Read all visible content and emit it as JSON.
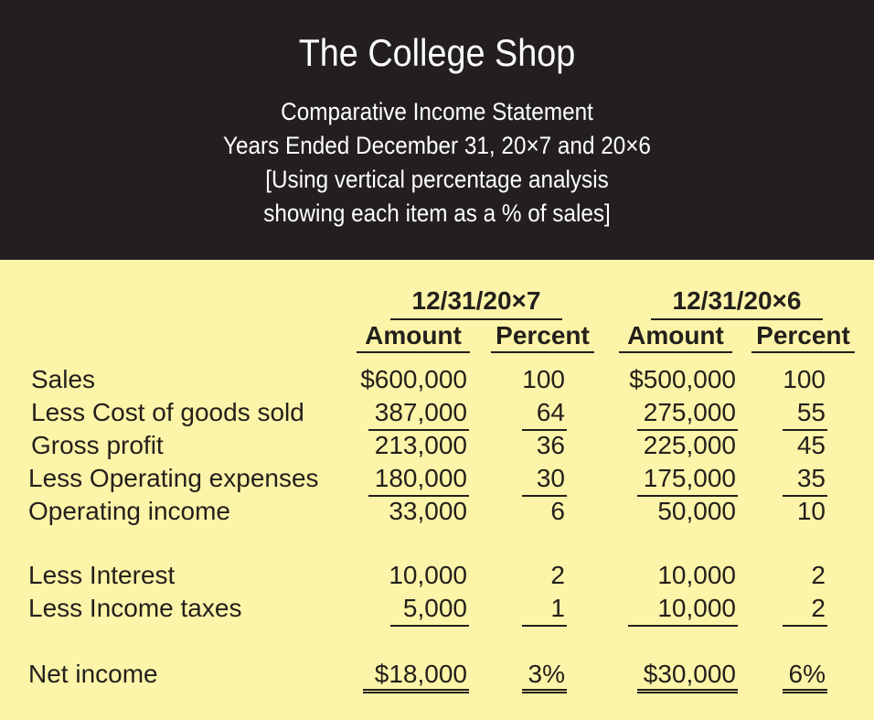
{
  "header": {
    "title": "The College Shop",
    "subtitle_lines": [
      "Comparative Income Statement",
      "Years Ended December 31, 20×7 and 20×6",
      "[Using vertical percentage analysis",
      "showing each item as a % of sales]"
    ]
  },
  "colors": {
    "header_bg": "#231f20",
    "body_bg": "#fcf4a8",
    "text": "#231f1c"
  },
  "columns": {
    "periods": [
      "12/31/20×7",
      "12/31/20×6"
    ],
    "amount_label": "Amount",
    "percent_label": "Percent"
  },
  "rows": [
    {
      "label": "Sales",
      "amt7": "$600,000",
      "pct7": "100",
      "amt6": "$500,000",
      "pct6": "100"
    },
    {
      "label": "Less Cost of goods sold",
      "amt7": "387,000",
      "pct7": "64",
      "amt6": "275,000",
      "pct6": "55"
    },
    {
      "label": "Gross profit",
      "amt7": "213,000",
      "pct7": "36",
      "amt6": "225,000",
      "pct6": "45"
    },
    {
      "label": "Less Operating expenses",
      "amt7": "180,000",
      "pct7": "30",
      "amt6": "175,000",
      "pct6": "35"
    },
    {
      "label": "Operating income",
      "amt7": "33,000",
      "pct7": "6",
      "amt6": "50,000",
      "pct6": "10"
    },
    {
      "label": "Less Interest",
      "amt7": "10,000",
      "pct7": "2",
      "amt6": "10,000",
      "pct6": "2"
    },
    {
      "label": "Less Income taxes",
      "amt7": "5,000",
      "pct7": "1",
      "amt6": "10,000",
      "pct6": "2"
    },
    {
      "label": "Net income",
      "amt7": "$18,000",
      "pct7": "3%",
      "amt6": "$30,000",
      "pct6": "6%"
    }
  ]
}
